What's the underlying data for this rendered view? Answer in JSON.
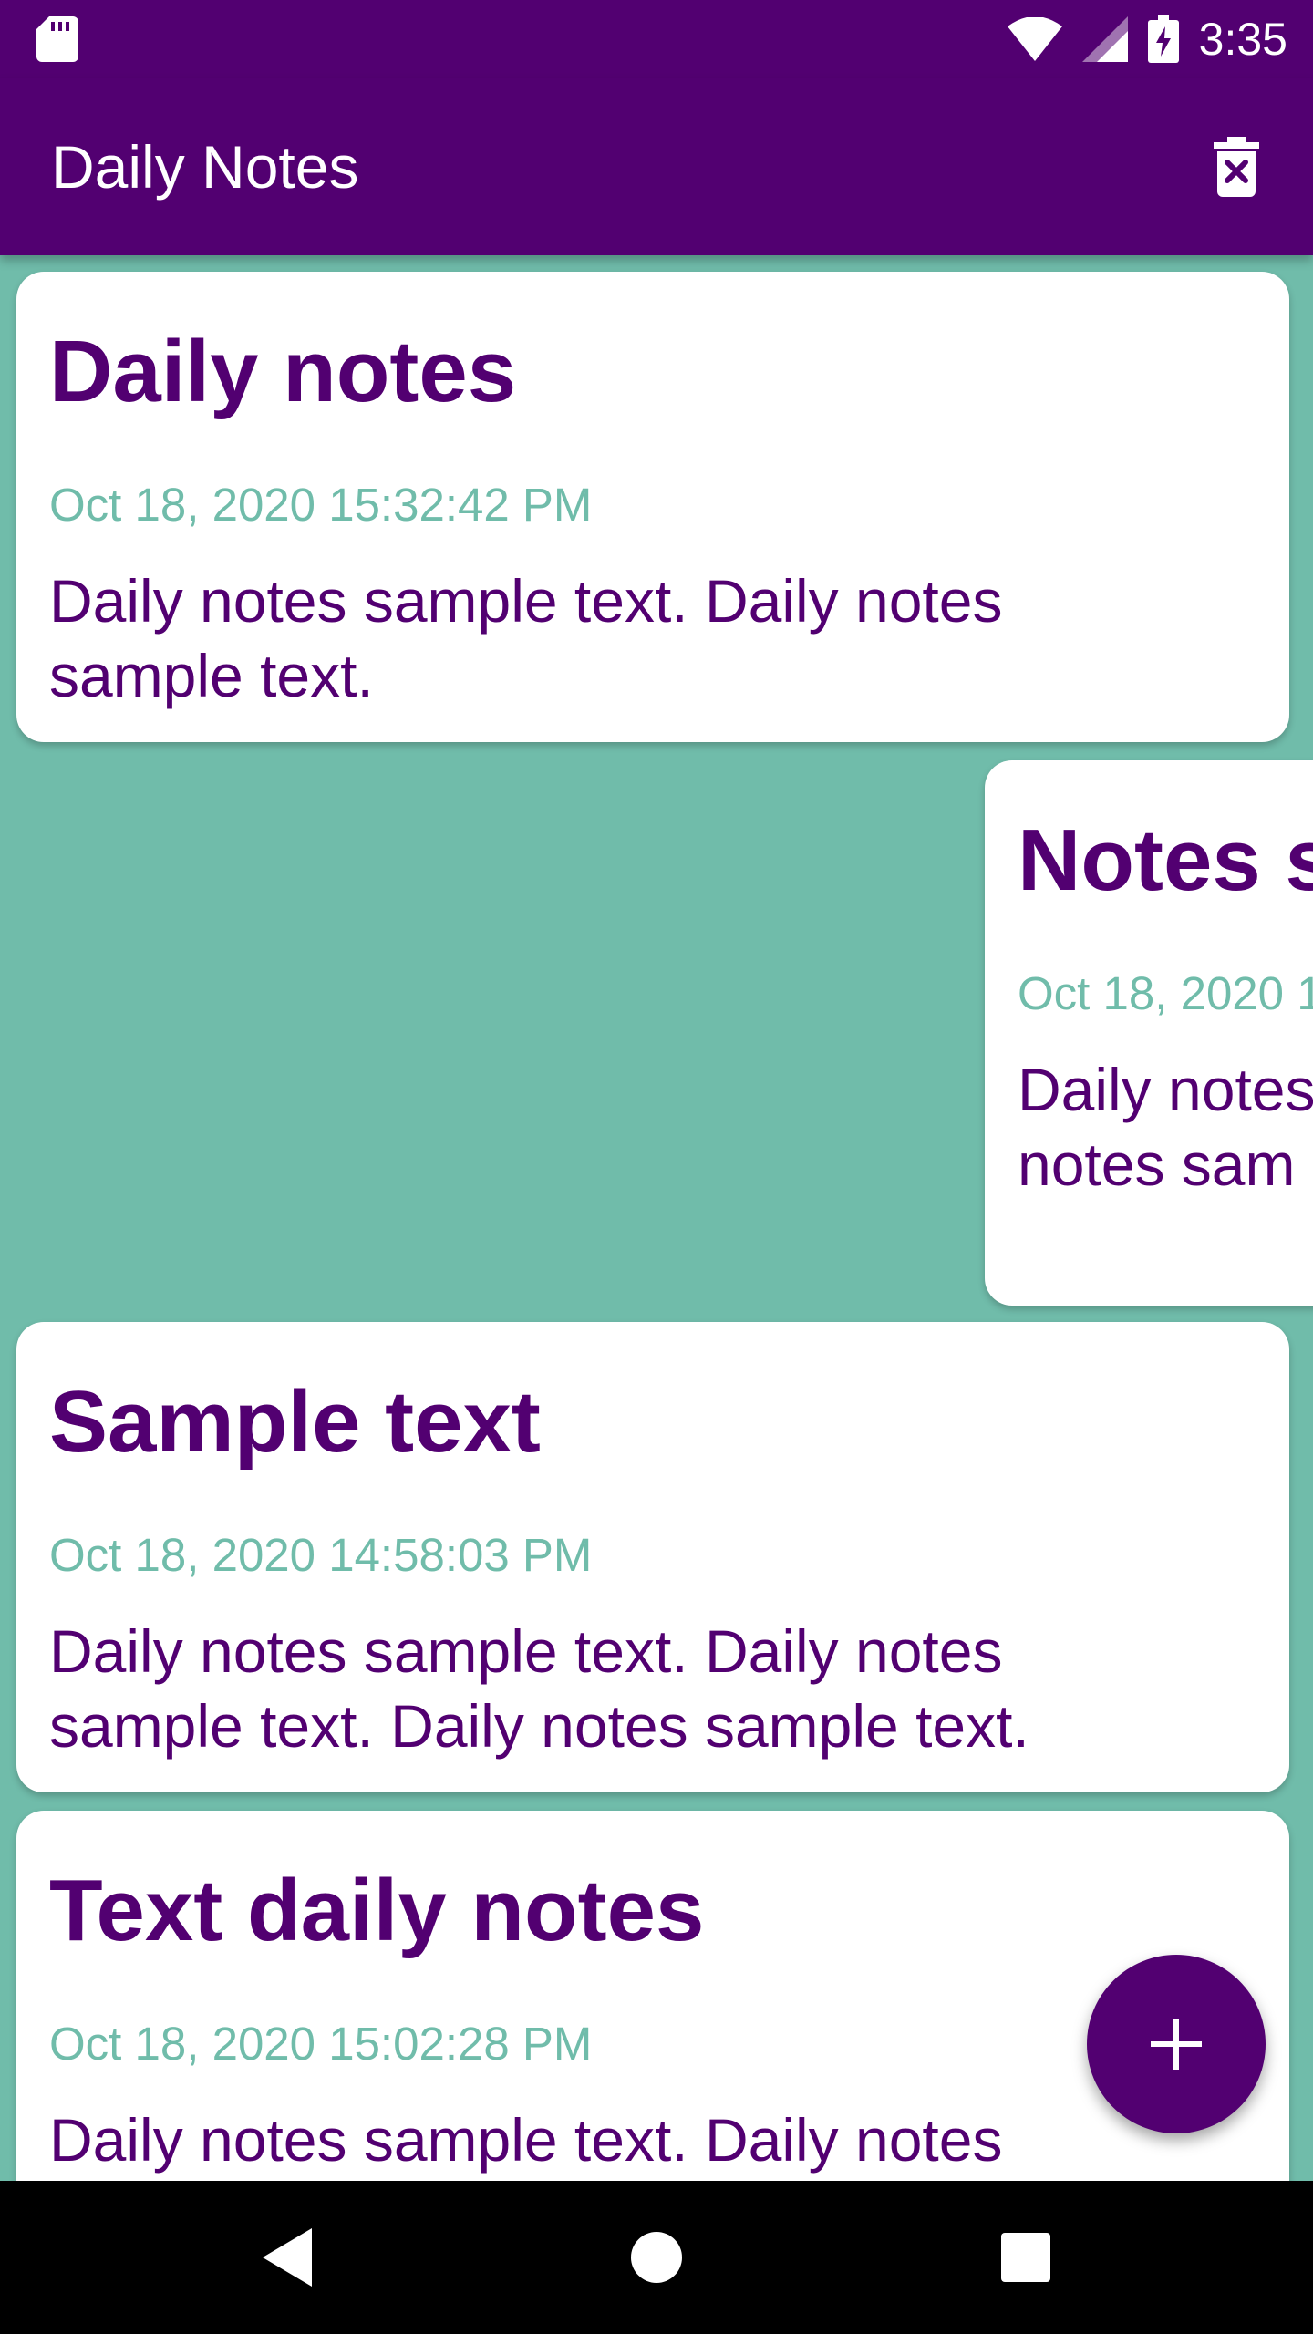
{
  "status_bar": {
    "time": "3:35",
    "icons": [
      "sd-card-icon",
      "wifi-icon",
      "cell-signal-icon",
      "battery-charging-icon"
    ]
  },
  "app_bar": {
    "title": "Daily Notes",
    "action_icon": "delete-all-icon"
  },
  "notes": [
    {
      "title": "Daily notes",
      "date": "Oct 18, 2020 15:32:42 PM",
      "body": "Daily notes sample text. Daily notes sample text."
    },
    {
      "title": "Notes s",
      "date": "Oct 18, 2020 1",
      "body": "Daily notes sample tex notes sam"
    },
    {
      "title": "Sample text",
      "date": "Oct 18, 2020 14:58:03 PM",
      "body": "Daily notes sample text. Daily notes sample text. Daily notes sample text."
    },
    {
      "title": "Text daily notes",
      "date": "Oct 18, 2020 15:02:28 PM",
      "body": "Daily notes sample text. Daily notes"
    }
  ],
  "fab": {
    "icon": "add-icon"
  },
  "nav_bar": {
    "icons": [
      "back-icon",
      "home-icon",
      "recents-icon"
    ]
  },
  "colors": {
    "primary": "#520071",
    "accent": "#70BCAA",
    "surface": "#FFFFFF",
    "nav_bar": "#000000"
  }
}
